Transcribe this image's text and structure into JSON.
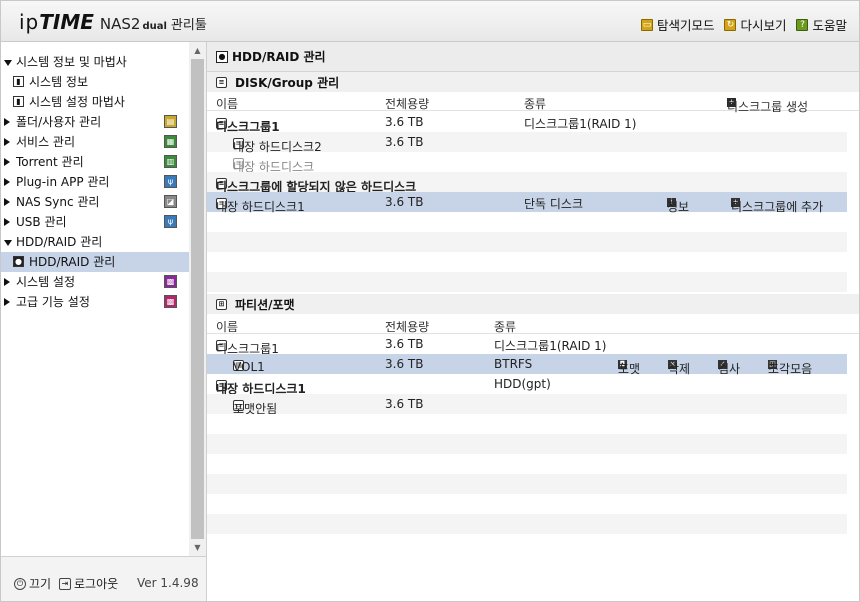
{
  "header": {
    "logo_ip": "ip",
    "logo_time": "TIME",
    "logo_nas": "NAS2",
    "logo_dual": "dual",
    "logo_admin": "관리툴",
    "links": {
      "search_mode": "탐색기모드",
      "refresh": "다시보기",
      "help": "도움말"
    }
  },
  "sidebar": {
    "items": {
      "system_info_wizard": "시스템 정보 및 마법사",
      "system_info": "시스템 정보",
      "system_setup_wizard": "시스템 설정 마법사",
      "folder_user": "폴더/사용자 관리",
      "service": "서비스 관리",
      "torrent": "Torrent 관리",
      "plugin": "Plug-in APP 관리",
      "nas_sync": "NAS Sync 관리",
      "usb": "USB 관리",
      "hdd_raid": "HDD/RAID 관리",
      "hdd_raid_sub": "HDD/RAID 관리",
      "system_settings": "시스템 설정",
      "advanced": "고급 기능 설정"
    }
  },
  "footer": {
    "power": "끄기",
    "logout": "로그아웃",
    "version": "Ver 1.4.98"
  },
  "main": {
    "title": "HDD/RAID 관리",
    "disk_section": {
      "title": "DISK/Group 관리",
      "headers": {
        "name": "이름",
        "capacity": "전체용량",
        "type": "종류",
        "create": "디스크그룹 생성"
      },
      "rows": {
        "group1": {
          "name": "디스크그룹1",
          "capacity": "3.6 TB",
          "type": "디스크그룹1(RAID 1)"
        },
        "disk2": {
          "name": "내장 하드디스크2",
          "capacity": "3.6 TB"
        },
        "disk_empty": {
          "name": "내장 하드디스크"
        },
        "unassigned": {
          "name": "디스크그룹에 할당되지 않은 하드디스크"
        },
        "disk1": {
          "name": "내장 하드디스크1",
          "capacity": "3.6 TB",
          "type": "단독 디스크",
          "info": "정보",
          "add": "디스크그룹에 추가"
        }
      }
    },
    "partition_section": {
      "title": "파티션/포맷",
      "headers": {
        "name": "이름",
        "capacity": "전체용량",
        "type": "종류"
      },
      "rows": {
        "group1": {
          "name": "디스크그룹1",
          "capacity": "3.6 TB",
          "type": "디스크그룹1(RAID 1)"
        },
        "vol1": {
          "name": "VOL1",
          "capacity": "3.6 TB",
          "type": "BTRFS",
          "format": "포맷",
          "delete": "삭제",
          "check": "검사",
          "defrag": "조각모음"
        },
        "disk1": {
          "name": "내장 하드디스크1",
          "type": "HDD(gpt)"
        },
        "unformatted": {
          "name": "포맷안됨",
          "capacity": "3.6 TB"
        }
      }
    }
  }
}
